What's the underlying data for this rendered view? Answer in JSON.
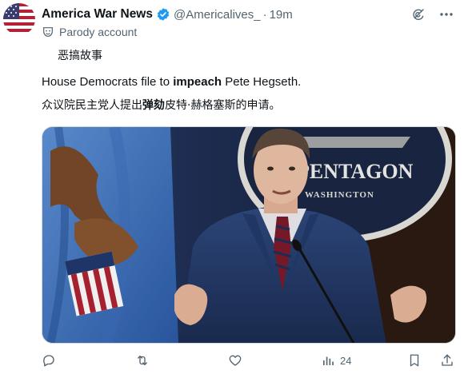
{
  "tweet": {
    "author_name": "America War News",
    "handle": "@Americalives_",
    "separator": "·",
    "time": "19m",
    "parody_label": "Parody account",
    "subtitle": "恶搞故事",
    "text_en_prefix": "House Democrats file to ",
    "text_en_bold": "impeach",
    "text_en_suffix": " Pete Hegseth.",
    "text_zh_prefix": "众议院民主党人提出",
    "text_zh_bold": "弹劾",
    "text_zh_suffix": "皮特·赫格塞斯的申请。",
    "media_sign_text": "PENTAGON",
    "media_sign_subtext": "WASHINGTON",
    "views_count": "24"
  },
  "colors": {
    "text_primary": "#0f1419",
    "text_secondary": "#536471",
    "verified_blue": "#1d9bf0",
    "border": "#cfd9de"
  },
  "icons": {
    "verified": "verified-badge-icon",
    "grok": "grok-icon",
    "more": "more-icon",
    "parody": "parody-mask-icon",
    "reply": "reply-icon",
    "retweet": "retweet-icon",
    "like": "like-icon",
    "views": "views-icon",
    "bookmark": "bookmark-icon",
    "share": "share-icon"
  }
}
